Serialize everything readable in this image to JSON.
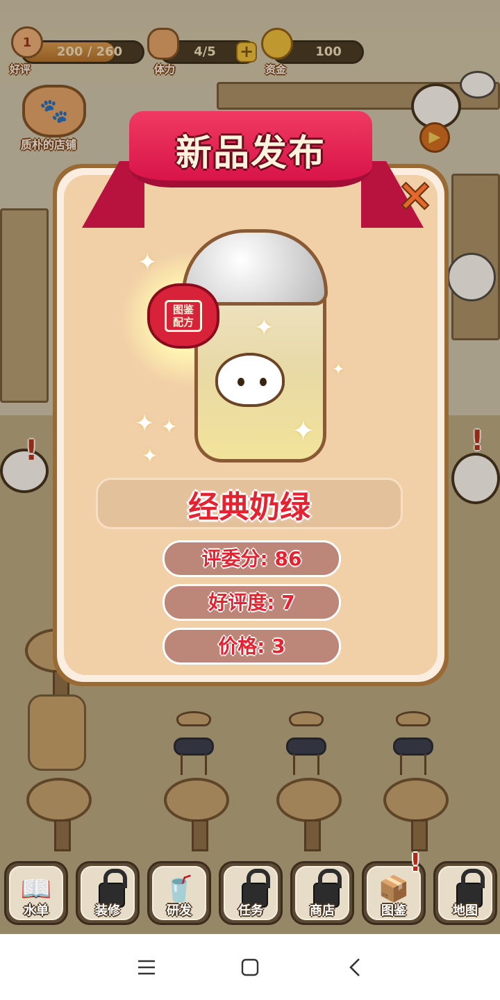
{
  "hud": {
    "rating": {
      "label": "好评",
      "value": "200 / 260",
      "fill_fraction": 0.77,
      "level": "1"
    },
    "stamina": {
      "label": "体力",
      "value": "4/5"
    },
    "funds": {
      "label": "资金",
      "value": "100"
    }
  },
  "shop": {
    "name": "质朴的店铺"
  },
  "dialog": {
    "title": "新品发布",
    "stamp_text": "图鉴配方",
    "drink_name": "经典奶绿",
    "stats": [
      {
        "label": "评委分: 86"
      },
      {
        "label": "好评度: 7"
      },
      {
        "label": "价格: 3"
      }
    ]
  },
  "menu": [
    {
      "label": "水单",
      "locked": false,
      "icon": "menu-book-icon"
    },
    {
      "label": "装修",
      "locked": true,
      "icon": "hammer-icon"
    },
    {
      "label": "研发",
      "locked": false,
      "icon": "cup-question-icon"
    },
    {
      "label": "任务",
      "locked": true,
      "icon": "scroll-icon"
    },
    {
      "label": "商店",
      "locked": true,
      "icon": "storefront-icon"
    },
    {
      "label": "图鉴",
      "locked": false,
      "icon": "catalog-box-icon",
      "alert": true
    },
    {
      "label": "地图",
      "locked": true,
      "icon": "map-icon"
    }
  ],
  "navbar": {
    "icons": [
      "menu-icon",
      "home-square-icon",
      "back-chevron-icon"
    ]
  },
  "colors": {
    "ribbon": "#e01a4b",
    "dialog_bg": "#f1cfa7",
    "stat_pill": "#bc8678",
    "name_text": "#e5222f"
  }
}
